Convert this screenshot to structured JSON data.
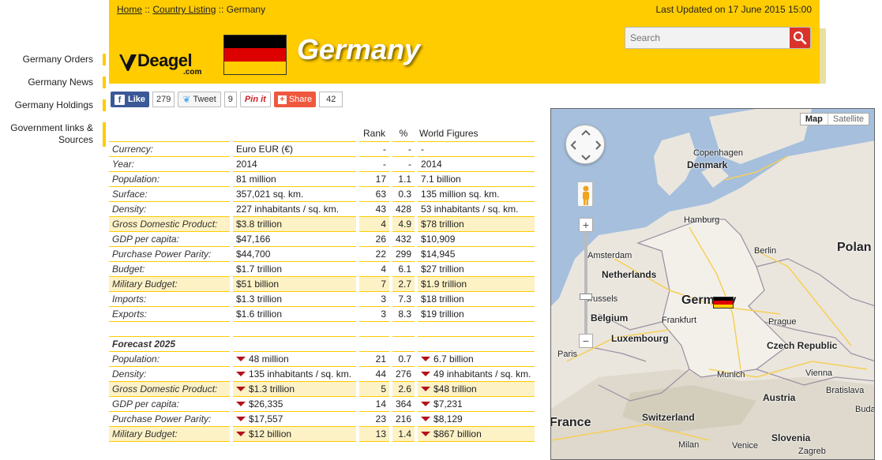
{
  "sidebar": {
    "items": [
      {
        "label": "Germany Orders"
      },
      {
        "label": "Germany News"
      },
      {
        "label": "Germany Holdings"
      },
      {
        "label": "Government links &"
      },
      {
        "label": "Sources"
      }
    ]
  },
  "header": {
    "breadcrumb": {
      "home": "Home",
      "sep1": " :: ",
      "country_listing": "Country Listing",
      "sep2": " :: ",
      "current": "Germany"
    },
    "last_updated": "Last Updated on 17 June 2015 15:00",
    "logo_word": "Deagel",
    "logo_dotcom": ".com",
    "title": "Germany",
    "search_placeholder": "Search",
    "flag_colors": [
      "#000000",
      "#dd0000",
      "#ffce00"
    ]
  },
  "social": {
    "like_label": "Like",
    "like_count": "279",
    "tweet_label": "Tweet",
    "tweet_count": "9",
    "pin_label": "Pin it",
    "share_label": "Share",
    "share_count": "42"
  },
  "table": {
    "headers": {
      "rank": "Rank",
      "pct": "%",
      "world": "World Figures"
    },
    "rows": [
      {
        "label": "Currency:",
        "value": "Euro EUR (€)",
        "rank": "-",
        "pct": "-",
        "world": "-"
      },
      {
        "label": "Year:",
        "value": "2014",
        "rank": "-",
        "pct": "-",
        "world": "2014"
      },
      {
        "label": "Population:",
        "value": "81 million",
        "rank": "17",
        "pct": "1.1",
        "world": "7.1 billion"
      },
      {
        "label": "Surface:",
        "value": "357,021 sq. km.",
        "rank": "63",
        "pct": "0.3",
        "world": "135 million sq. km."
      },
      {
        "label": "Density:",
        "value": "227 inhabitants / sq. km.",
        "rank": "43",
        "pct": "428",
        "world": "53 inhabitants / sq. km."
      },
      {
        "label": "Gross Domestic Product:",
        "value": "$3.8 trillion",
        "rank": "4",
        "pct": "4.9",
        "world": "$78 trillion"
      },
      {
        "label": "GDP per capita:",
        "value": "$47,166",
        "rank": "26",
        "pct": "432",
        "world": "$10,909"
      },
      {
        "label": "Purchase Power Parity:",
        "value": "$44,700",
        "rank": "22",
        "pct": "299",
        "world": "$14,945"
      },
      {
        "label": "Budget:",
        "value": "$1.7 trillion",
        "rank": "4",
        "pct": "6.1",
        "world": "$27 trillion"
      },
      {
        "label": "Military Budget:",
        "value": "$51 billion",
        "rank": "7",
        "pct": "2.7",
        "world": "$1.9 trillion"
      },
      {
        "label": "Imports:",
        "value": "$1.3 trillion",
        "rank": "3",
        "pct": "7.3",
        "world": "$18 trillion"
      },
      {
        "label": "Exports:",
        "value": "$1.6 trillion",
        "rank": "3",
        "pct": "8.3",
        "world": "$19 trillion"
      }
    ],
    "forecast_title": "Forecast 2025",
    "forecast_rows": [
      {
        "label": "Population:",
        "value": "48 million",
        "rank": "21",
        "pct": "0.7",
        "world": "6.7 billion"
      },
      {
        "label": "Density:",
        "value": "135 inhabitants / sq. km.",
        "rank": "44",
        "pct": "276",
        "world": "49 inhabitants / sq. km."
      },
      {
        "label": "Gross Domestic Product:",
        "value": "$1.3 trillion",
        "rank": "5",
        "pct": "2.6",
        "world": "$48 trillion"
      },
      {
        "label": "GDP per capita:",
        "value": "$26,335",
        "rank": "14",
        "pct": "364",
        "world": "$7,231"
      },
      {
        "label": "Purchase Power Parity:",
        "value": "$17,557",
        "rank": "23",
        "pct": "216",
        "world": "$8,129"
      },
      {
        "label": "Military Budget:",
        "value": "$12 billion",
        "rank": "13",
        "pct": "1.4",
        "world": "$867 billion"
      }
    ]
  },
  "map": {
    "type_map": "Map",
    "type_satellite": "Satellite",
    "zoom_in": "+",
    "zoom_out": "−",
    "labels": {
      "copenhagen": "Copenhagen",
      "denmark": "Denmark",
      "hamburg": "Hamburg",
      "amsterdam": "Amsterdam",
      "netherlands": "Netherlands",
      "berlin": "Berlin",
      "poland": "Polan",
      "brussels": "Brussels",
      "belgium": "Belgium",
      "germany": "Germany",
      "frankfurt": "Frankfurt",
      "prague": "Prague",
      "luxembourg": "Luxembourg",
      "czech": "Czech Republic",
      "paris": "Paris",
      "munich": "Munich",
      "vienna": "Vienna",
      "austria": "Austria",
      "bratislava": "Bratislava",
      "buda": "Buda",
      "france": "France",
      "switzerland": "Switzerland",
      "slovenia": "Slovenia",
      "milan": "Milan",
      "venice": "Venice",
      "zagreb": "Zagreb"
    }
  }
}
